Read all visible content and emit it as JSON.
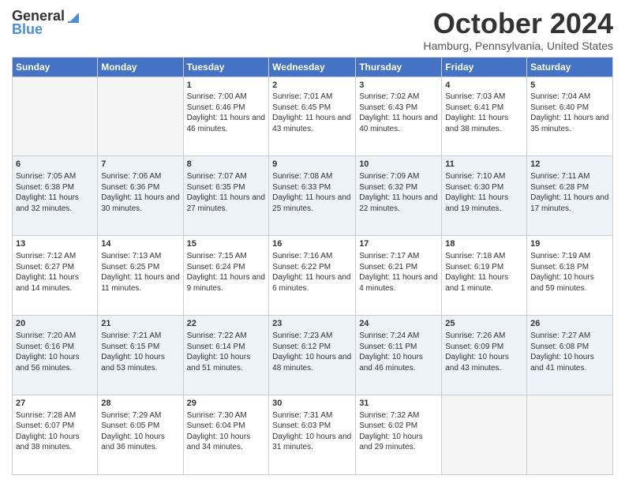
{
  "header": {
    "logo_general": "General",
    "logo_blue": "Blue",
    "month_title": "October 2024",
    "location": "Hamburg, Pennsylvania, United States"
  },
  "calendar": {
    "days_of_week": [
      "Sunday",
      "Monday",
      "Tuesday",
      "Wednesday",
      "Thursday",
      "Friday",
      "Saturday"
    ],
    "weeks": [
      [
        {
          "day": "",
          "sunrise": "",
          "sunset": "",
          "daylight": ""
        },
        {
          "day": "",
          "sunrise": "",
          "sunset": "",
          "daylight": ""
        },
        {
          "day": "1",
          "sunrise": "Sunrise: 7:00 AM",
          "sunset": "Sunset: 6:46 PM",
          "daylight": "Daylight: 11 hours and 46 minutes."
        },
        {
          "day": "2",
          "sunrise": "Sunrise: 7:01 AM",
          "sunset": "Sunset: 6:45 PM",
          "daylight": "Daylight: 11 hours and 43 minutes."
        },
        {
          "day": "3",
          "sunrise": "Sunrise: 7:02 AM",
          "sunset": "Sunset: 6:43 PM",
          "daylight": "Daylight: 11 hours and 40 minutes."
        },
        {
          "day": "4",
          "sunrise": "Sunrise: 7:03 AM",
          "sunset": "Sunset: 6:41 PM",
          "daylight": "Daylight: 11 hours and 38 minutes."
        },
        {
          "day": "5",
          "sunrise": "Sunrise: 7:04 AM",
          "sunset": "Sunset: 6:40 PM",
          "daylight": "Daylight: 11 hours and 35 minutes."
        }
      ],
      [
        {
          "day": "6",
          "sunrise": "Sunrise: 7:05 AM",
          "sunset": "Sunset: 6:38 PM",
          "daylight": "Daylight: 11 hours and 32 minutes."
        },
        {
          "day": "7",
          "sunrise": "Sunrise: 7:06 AM",
          "sunset": "Sunset: 6:36 PM",
          "daylight": "Daylight: 11 hours and 30 minutes."
        },
        {
          "day": "8",
          "sunrise": "Sunrise: 7:07 AM",
          "sunset": "Sunset: 6:35 PM",
          "daylight": "Daylight: 11 hours and 27 minutes."
        },
        {
          "day": "9",
          "sunrise": "Sunrise: 7:08 AM",
          "sunset": "Sunset: 6:33 PM",
          "daylight": "Daylight: 11 hours and 25 minutes."
        },
        {
          "day": "10",
          "sunrise": "Sunrise: 7:09 AM",
          "sunset": "Sunset: 6:32 PM",
          "daylight": "Daylight: 11 hours and 22 minutes."
        },
        {
          "day": "11",
          "sunrise": "Sunrise: 7:10 AM",
          "sunset": "Sunset: 6:30 PM",
          "daylight": "Daylight: 11 hours and 19 minutes."
        },
        {
          "day": "12",
          "sunrise": "Sunrise: 7:11 AM",
          "sunset": "Sunset: 6:28 PM",
          "daylight": "Daylight: 11 hours and 17 minutes."
        }
      ],
      [
        {
          "day": "13",
          "sunrise": "Sunrise: 7:12 AM",
          "sunset": "Sunset: 6:27 PM",
          "daylight": "Daylight: 11 hours and 14 minutes."
        },
        {
          "day": "14",
          "sunrise": "Sunrise: 7:13 AM",
          "sunset": "Sunset: 6:25 PM",
          "daylight": "Daylight: 11 hours and 11 minutes."
        },
        {
          "day": "15",
          "sunrise": "Sunrise: 7:15 AM",
          "sunset": "Sunset: 6:24 PM",
          "daylight": "Daylight: 11 hours and 9 minutes."
        },
        {
          "day": "16",
          "sunrise": "Sunrise: 7:16 AM",
          "sunset": "Sunset: 6:22 PM",
          "daylight": "Daylight: 11 hours and 6 minutes."
        },
        {
          "day": "17",
          "sunrise": "Sunrise: 7:17 AM",
          "sunset": "Sunset: 6:21 PM",
          "daylight": "Daylight: 11 hours and 4 minutes."
        },
        {
          "day": "18",
          "sunrise": "Sunrise: 7:18 AM",
          "sunset": "Sunset: 6:19 PM",
          "daylight": "Daylight: 11 hours and 1 minute."
        },
        {
          "day": "19",
          "sunrise": "Sunrise: 7:19 AM",
          "sunset": "Sunset: 6:18 PM",
          "daylight": "Daylight: 10 hours and 59 minutes."
        }
      ],
      [
        {
          "day": "20",
          "sunrise": "Sunrise: 7:20 AM",
          "sunset": "Sunset: 6:16 PM",
          "daylight": "Daylight: 10 hours and 56 minutes."
        },
        {
          "day": "21",
          "sunrise": "Sunrise: 7:21 AM",
          "sunset": "Sunset: 6:15 PM",
          "daylight": "Daylight: 10 hours and 53 minutes."
        },
        {
          "day": "22",
          "sunrise": "Sunrise: 7:22 AM",
          "sunset": "Sunset: 6:14 PM",
          "daylight": "Daylight: 10 hours and 51 minutes."
        },
        {
          "day": "23",
          "sunrise": "Sunrise: 7:23 AM",
          "sunset": "Sunset: 6:12 PM",
          "daylight": "Daylight: 10 hours and 48 minutes."
        },
        {
          "day": "24",
          "sunrise": "Sunrise: 7:24 AM",
          "sunset": "Sunset: 6:11 PM",
          "daylight": "Daylight: 10 hours and 46 minutes."
        },
        {
          "day": "25",
          "sunrise": "Sunrise: 7:26 AM",
          "sunset": "Sunset: 6:09 PM",
          "daylight": "Daylight: 10 hours and 43 minutes."
        },
        {
          "day": "26",
          "sunrise": "Sunrise: 7:27 AM",
          "sunset": "Sunset: 6:08 PM",
          "daylight": "Daylight: 10 hours and 41 minutes."
        }
      ],
      [
        {
          "day": "27",
          "sunrise": "Sunrise: 7:28 AM",
          "sunset": "Sunset: 6:07 PM",
          "daylight": "Daylight: 10 hours and 38 minutes."
        },
        {
          "day": "28",
          "sunrise": "Sunrise: 7:29 AM",
          "sunset": "Sunset: 6:05 PM",
          "daylight": "Daylight: 10 hours and 36 minutes."
        },
        {
          "day": "29",
          "sunrise": "Sunrise: 7:30 AM",
          "sunset": "Sunset: 6:04 PM",
          "daylight": "Daylight: 10 hours and 34 minutes."
        },
        {
          "day": "30",
          "sunrise": "Sunrise: 7:31 AM",
          "sunset": "Sunset: 6:03 PM",
          "daylight": "Daylight: 10 hours and 31 minutes."
        },
        {
          "day": "31",
          "sunrise": "Sunrise: 7:32 AM",
          "sunset": "Sunset: 6:02 PM",
          "daylight": "Daylight: 10 hours and 29 minutes."
        },
        {
          "day": "",
          "sunrise": "",
          "sunset": "",
          "daylight": ""
        },
        {
          "day": "",
          "sunrise": "",
          "sunset": "",
          "daylight": ""
        }
      ]
    ]
  }
}
